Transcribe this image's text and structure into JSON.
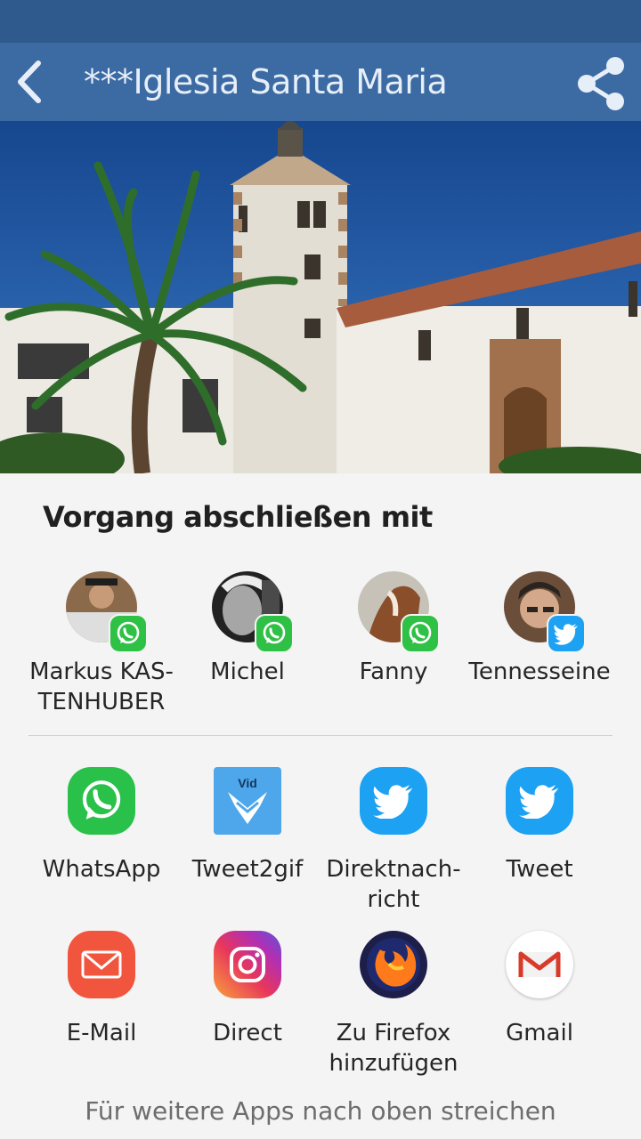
{
  "app_bar": {
    "title": "***Iglesia Santa Maria",
    "back_icon": "back-arrow-icon",
    "share_icon": "share-icon",
    "color": "#3c6aa3"
  },
  "sheet": {
    "title": "Vorgang abschließen mit",
    "contacts": [
      {
        "name": "Markus KAS-\nTENHUBER",
        "badge": "whatsapp-icon"
      },
      {
        "name": "Michel",
        "badge": "whatsapp-icon"
      },
      {
        "name": "Fanny",
        "badge": "whatsapp-icon"
      },
      {
        "name": "Tennesseine",
        "badge": "twitter-icon"
      }
    ],
    "apps": [
      {
        "label": "WhatsApp",
        "icon": "whatsapp-icon"
      },
      {
        "label": "Tweet2gif",
        "icon": "tweet2gif-icon",
        "icon_text": "Vid"
      },
      {
        "label": "Direktnach-\nricht",
        "icon": "twitter-icon"
      },
      {
        "label": "Tweet",
        "icon": "twitter-icon"
      },
      {
        "label": "E-Mail",
        "icon": "email-icon"
      },
      {
        "label": "Direct",
        "icon": "instagram-icon"
      },
      {
        "label": "Zu Firefox\nhinzufügen",
        "icon": "firefox-icon"
      },
      {
        "label": "Gmail",
        "icon": "gmail-icon"
      }
    ],
    "hint": "Für weitere Apps nach oben streichen"
  }
}
